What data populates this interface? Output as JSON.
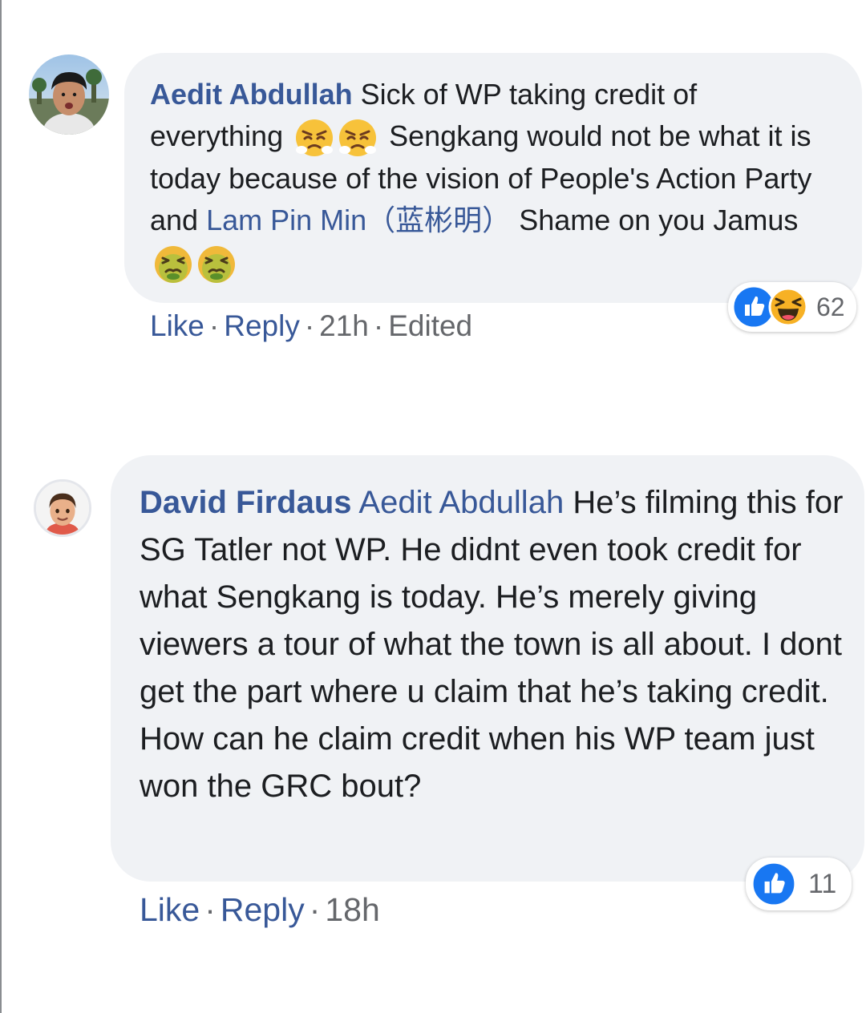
{
  "comments": [
    {
      "author": "Aedit Abdullah",
      "avatar_icon": "boy-selfie-photo-avatar",
      "text_1": "Sick of WP taking credit of everything",
      "emoji_1": "triumph-face-emoji",
      "text_2": "Sengkang would not be what it is today because of the vision of People's Action Party and",
      "mention": "Lam Pin Min（蓝彬明）",
      "text_3": "Shame on you Jamus",
      "emoji_2": "nauseated-face-emoji",
      "actions": {
        "like": "Like",
        "reply": "Reply",
        "time": "21h",
        "edited": "Edited"
      },
      "reactions": {
        "icons": [
          "like-icon",
          "haha-icon"
        ],
        "count": "62"
      }
    },
    {
      "author": "David Firdaus",
      "avatar_icon": "memoji-boy-avatar",
      "mention": "Aedit Abdullah",
      "text": "He’s filming this for SG Tatler not WP. He didnt even took credit for what Sengkang is today. He’s merely giving viewers a tour of what the town is all about. I dont get the part where u claim that he’s taking credit. How can he claim credit when his WP team just won the GRC bout?",
      "actions": {
        "like": "Like",
        "reply": "Reply",
        "time": "18h"
      },
      "reactions": {
        "icons": [
          "like-icon"
        ],
        "count": "11"
      }
    }
  ],
  "colors": {
    "link": "#385898",
    "bubble": "#f0f2f5",
    "meta": "#65676b",
    "like_blue": "#1877f2"
  }
}
